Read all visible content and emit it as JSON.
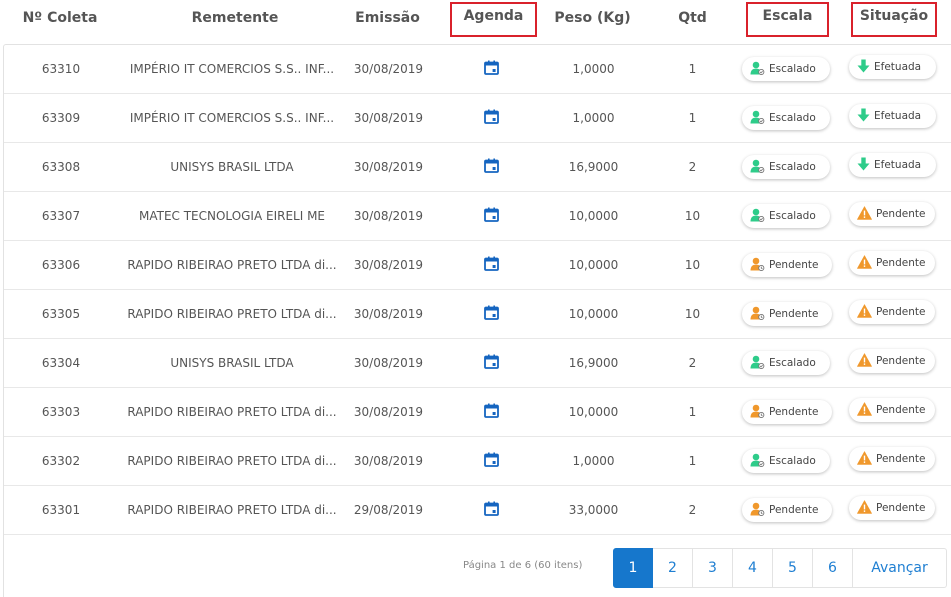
{
  "headers": {
    "coleta": "Nº Coleta",
    "remetente": "Remetente",
    "emissao": "Emissão",
    "agenda": "Agenda",
    "peso": "Peso (Kg)",
    "qtd": "Qtd",
    "escala": "Escala",
    "situacao": "Situação"
  },
  "rows": [
    {
      "coleta": "63310",
      "remetente": "IMPÉRIO IT COMERCIOS S.S.. INF...",
      "emissao": "30/08/2019",
      "peso": "1,0000",
      "qtd": "1",
      "escala": "Escalado",
      "situacao": "Efetuada"
    },
    {
      "coleta": "63309",
      "remetente": "IMPÉRIO IT COMERCIOS S.S.. INF...",
      "emissao": "30/08/2019",
      "peso": "1,0000",
      "qtd": "1",
      "escala": "Escalado",
      "situacao": "Efetuada"
    },
    {
      "coleta": "63308",
      "remetente": "UNISYS BRASIL LTDA",
      "emissao": "30/08/2019",
      "peso": "16,9000",
      "qtd": "2",
      "escala": "Escalado",
      "situacao": "Efetuada"
    },
    {
      "coleta": "63307",
      "remetente": "MATEC TECNOLOGIA EIRELI ME",
      "emissao": "30/08/2019",
      "peso": "10,0000",
      "qtd": "10",
      "escala": "Escalado",
      "situacao": "Pendente"
    },
    {
      "coleta": "63306",
      "remetente": "RAPIDO RIBEIRAO PRETO LTDA di...",
      "emissao": "30/08/2019",
      "peso": "10,0000",
      "qtd": "10",
      "escala": "Pendente",
      "situacao": "Pendente"
    },
    {
      "coleta": "63305",
      "remetente": "RAPIDO RIBEIRAO PRETO LTDA di...",
      "emissao": "30/08/2019",
      "peso": "10,0000",
      "qtd": "10",
      "escala": "Pendente",
      "situacao": "Pendente"
    },
    {
      "coleta": "63304",
      "remetente": "UNISYS BRASIL LTDA",
      "emissao": "30/08/2019",
      "peso": "16,9000",
      "qtd": "2",
      "escala": "Escalado",
      "situacao": "Pendente"
    },
    {
      "coleta": "63303",
      "remetente": "RAPIDO RIBEIRAO PRETO LTDA di...",
      "emissao": "30/08/2019",
      "peso": "10,0000",
      "qtd": "1",
      "escala": "Pendente",
      "situacao": "Pendente"
    },
    {
      "coleta": "63302",
      "remetente": "RAPIDO RIBEIRAO PRETO LTDA di...",
      "emissao": "30/08/2019",
      "peso": "1,0000",
      "qtd": "1",
      "escala": "Escalado",
      "situacao": "Pendente"
    },
    {
      "coleta": "63301",
      "remetente": "RAPIDO RIBEIRAO PRETO LTDA di...",
      "emissao": "29/08/2019",
      "peso": "33,0000",
      "qtd": "2",
      "escala": "Pendente",
      "situacao": "Pendente"
    }
  ],
  "icons": {
    "agenda": "calendar-icon",
    "escalado": "user-check-icon",
    "pendente_escala": "user-clock-icon",
    "efetuada": "arrow-down-icon",
    "pendente_situacao": "warning-triangle-icon"
  },
  "colors": {
    "highlight_border": "#d9212b",
    "primary": "#1677cc",
    "calendar": "#1565c0",
    "success": "#2ecc8a",
    "warning": "#f0982c"
  },
  "pagination": {
    "info": "Página 1 de 6 (60 itens)",
    "pages": [
      "1",
      "2",
      "3",
      "4",
      "5",
      "6"
    ],
    "current": "1",
    "next_label": "Avançar"
  }
}
